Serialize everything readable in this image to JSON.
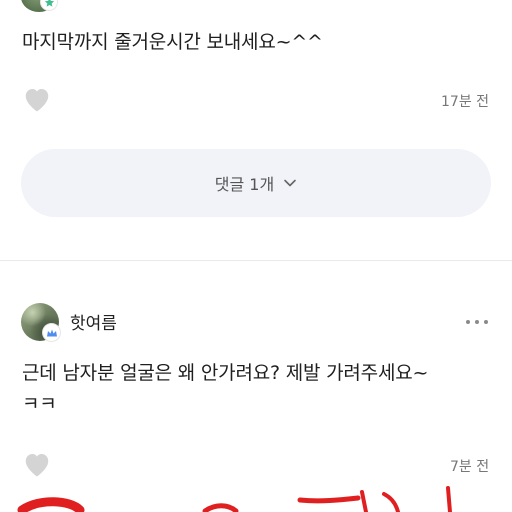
{
  "comments": [
    {
      "text": "마지막까지 줄거운시간 보내세요~^^",
      "time": "17분 전",
      "reply_label": "댓글 1개"
    },
    {
      "author": "핫여름",
      "text_line1": "근데 남자분 얼굴은 왜 안가려요? 제발 가려주세요~",
      "text_line2": "ㅋㅋ",
      "time": "7분 전"
    }
  ],
  "icons": {
    "like": "heart-icon",
    "more": "more-dots-icon",
    "expand": "chevron-down-icon",
    "badge_star": "star-badge-icon",
    "badge_crown": "crown-badge-icon"
  },
  "colors": {
    "heart": "#d4d4d4",
    "reply_bg": "#f2f3f8",
    "star_badge": "#3fbf8f",
    "crown_badge": "#4d8ef0",
    "scribble": "#e02020"
  }
}
